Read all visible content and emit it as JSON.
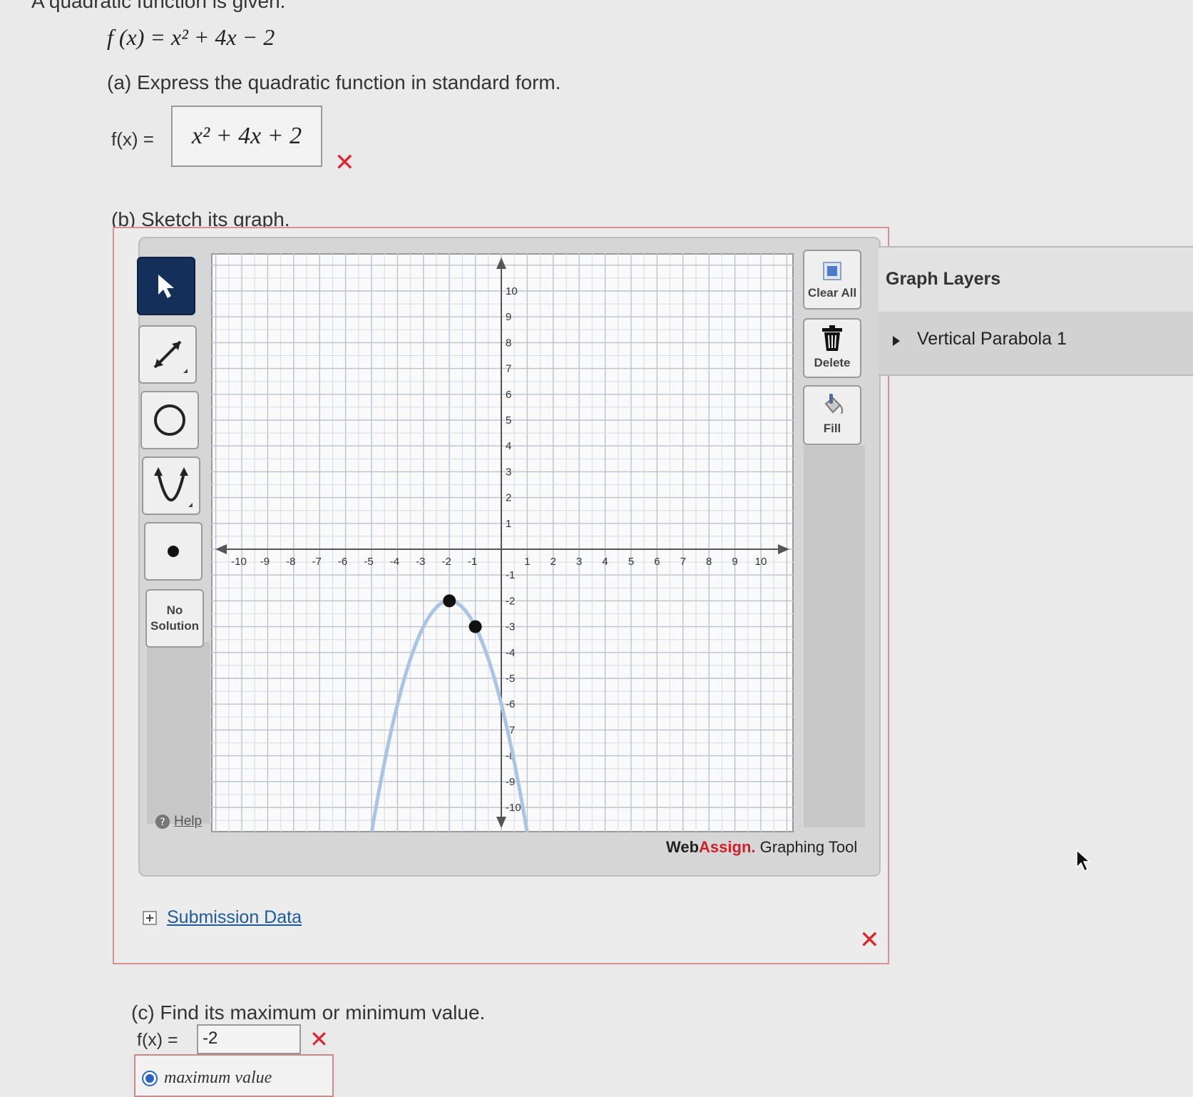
{
  "header": {
    "intro": "A quadratic function is given.",
    "function_lhs": "f (x) = ",
    "function_expr": "x² + 4x − 2"
  },
  "part_a": {
    "prompt": "(a) Express the quadratic function in standard form.",
    "lhs": "f(x) =",
    "answer": "x² + 4x + 2",
    "status_icon": "incorrect-x-icon"
  },
  "part_b": {
    "prompt": "(b) Sketch its graph."
  },
  "graph_tool": {
    "tools": [
      "select-arrow-icon",
      "line-icon",
      "circle-icon",
      "parabola-icon",
      "point-icon"
    ],
    "no_solution_line1": "No",
    "no_solution_line2": "Solution",
    "help_label": "Help",
    "clear_all_label": "Clear All",
    "delete_label": "Delete",
    "fill_label": "Fill",
    "brand_web": "Web",
    "brand_assign": "Assign.",
    "brand_rest": " Graphing Tool",
    "layers_title": "Graph Layers",
    "layer_item": "Vertical Parabola 1",
    "accent_color": "#14305a",
    "brand_red": "#d0202a"
  },
  "graph": {
    "xlim": [
      -10,
      10
    ],
    "ylim": [
      -10,
      10
    ],
    "x_ticks": [
      -10,
      -9,
      -8,
      -7,
      -6,
      -5,
      -4,
      -3,
      -2,
      -1,
      1,
      2,
      3,
      4,
      5,
      6,
      7,
      8,
      9,
      10
    ],
    "y_ticks": [
      -10,
      -9,
      -8,
      -7,
      -6,
      -5,
      -4,
      -3,
      -2,
      -1,
      1,
      2,
      3,
      4,
      5,
      6,
      7,
      8,
      9,
      10
    ],
    "vertex": [
      -2,
      -2
    ],
    "second_point": [
      -1,
      -3
    ],
    "curve_color": "#a9c4e4",
    "point_color": "#111111"
  },
  "submission": {
    "label": "Submission Data",
    "status_icon": "incorrect-x-icon"
  },
  "part_c": {
    "prompt": "(c) Find its maximum or minimum value.",
    "lhs": "f(x) =",
    "answer": "-2",
    "option_label": "maximum value"
  }
}
